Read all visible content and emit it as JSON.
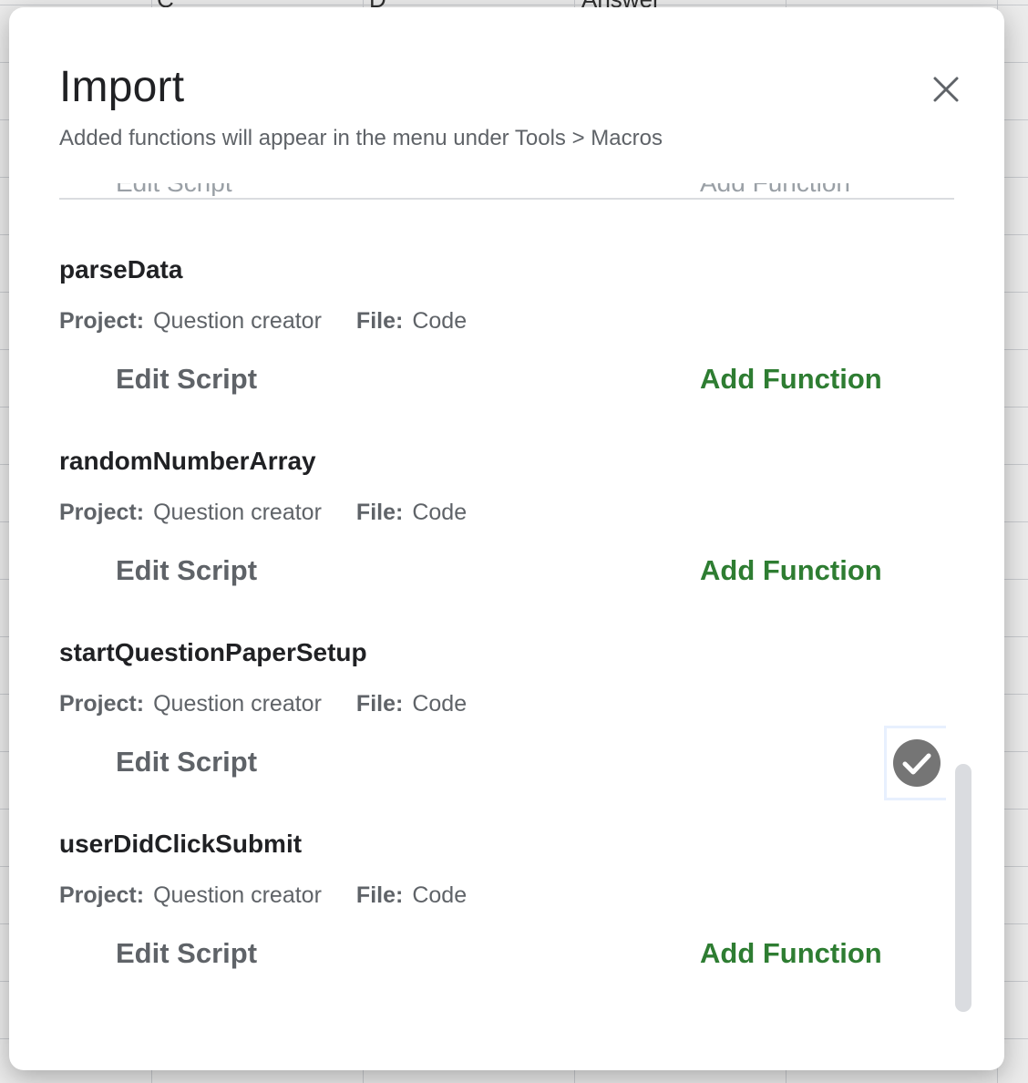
{
  "background": {
    "column_headers": [
      "C",
      "D",
      "Answer"
    ]
  },
  "dialog": {
    "title": "Import",
    "subtitle": "Added functions will appear in the menu under Tools > Macros",
    "close_icon": "close-icon",
    "partially_hidden_row": {
      "left_text": "Edit Script",
      "right_text": "Add Function"
    },
    "functions": [
      {
        "name": "parseData",
        "project_label": "Project:",
        "project_value": "Question creator",
        "file_label": "File:",
        "file_value": "Code",
        "edit_label": "Edit Script",
        "add_label": "Add Function",
        "added": false
      },
      {
        "name": "randomNumberArray",
        "project_label": "Project:",
        "project_value": "Question creator",
        "file_label": "File:",
        "file_value": "Code",
        "edit_label": "Edit Script",
        "add_label": "Add Function",
        "added": false
      },
      {
        "name": "startQuestionPaperSetup",
        "project_label": "Project:",
        "project_value": "Question creator",
        "file_label": "File:",
        "file_value": "Code",
        "edit_label": "Edit Script",
        "add_label": "",
        "added": true,
        "added_icon": "check-circle-icon"
      },
      {
        "name": "userDidClickSubmit",
        "project_label": "Project:",
        "project_value": "Question creator",
        "file_label": "File:",
        "file_value": "Code",
        "edit_label": "Edit Script",
        "add_label": "Add Function",
        "added": false
      }
    ]
  },
  "colors": {
    "accent_green": "#2e7d32",
    "text_dark": "#202124",
    "text_muted": "#5f6368",
    "check_gray": "#757575"
  }
}
